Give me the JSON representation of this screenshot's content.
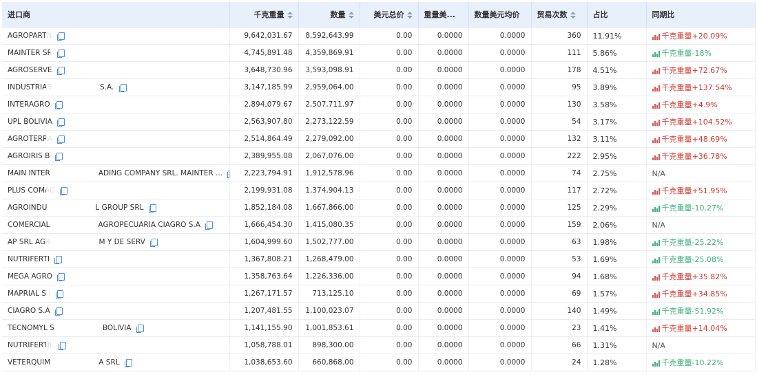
{
  "columns": {
    "importer": "进口商",
    "weight_kg": "千克重量",
    "quantity": "数量",
    "usd_total": "美元总价",
    "weight_usd": "重量美...",
    "qty_usd_avg": "数量美元均价",
    "trade_count": "贸易次数",
    "share": "占比",
    "yoy": "同期比"
  },
  "rows": [
    {
      "name": "AGROPARTN",
      "suffix": "",
      "weight": "9,642,031.67",
      "qty": "8,592,643.99",
      "usd": "0.00",
      "wusd": "0.0000",
      "qusd": "0.0000",
      "count": "360",
      "share": "11.91%",
      "trend": "up",
      "yoy_label": "千克重量",
      "yoy_value": "+20.09%"
    },
    {
      "name": "MAINTER SR",
      "suffix": "",
      "weight": "4,745,891.48",
      "qty": "4,359,869.91",
      "usd": "0.00",
      "wusd": "0.0000",
      "qusd": "0.0000",
      "count": "111",
      "share": "5.86%",
      "trend": "down",
      "yoy_label": "千克重量",
      "yoy_value": "-18%"
    },
    {
      "name": "AGROSERVE",
      "suffix": "",
      "weight": "3,648,730.96",
      "qty": "3,593,098.91",
      "usd": "0.00",
      "wusd": "0.0000",
      "qusd": "0.0000",
      "count": "178",
      "share": "4.51%",
      "trend": "up",
      "yoy_label": "千克重量",
      "yoy_value": "+72.67%"
    },
    {
      "name": "INDUSTRIAS",
      "suffix": "S.A.",
      "weight": "3,147,185.99",
      "qty": "2,959,064.00",
      "usd": "0.00",
      "wusd": "0.0000",
      "qusd": "0.0000",
      "count": "95",
      "share": "3.89%",
      "trend": "up",
      "yoy_label": "千克重量",
      "yoy_value": "+137.54%"
    },
    {
      "name": "INTERAGRO",
      "suffix": "",
      "weight": "2,894,079.67",
      "qty": "2,507,711.97",
      "usd": "0.00",
      "wusd": "0.0000",
      "qusd": "0.0000",
      "count": "130",
      "share": "3.58%",
      "trend": "up",
      "yoy_label": "千克重量",
      "yoy_value": "+4.9%"
    },
    {
      "name": "UPL BOLIVIA",
      "suffix": "",
      "weight": "2,563,907.80",
      "qty": "2,273,122.59",
      "usd": "0.00",
      "wusd": "0.0000",
      "qusd": "0.0000",
      "count": "54",
      "share": "3.17%",
      "trend": "up",
      "yoy_label": "千克重量",
      "yoy_value": "+104.52%"
    },
    {
      "name": "AGROTERRA",
      "suffix": "",
      "weight": "2,514,864.49",
      "qty": "2,279,092.00",
      "usd": "0.00",
      "wusd": "0.0000",
      "qusd": "0.0000",
      "count": "132",
      "share": "3.11%",
      "trend": "up",
      "yoy_label": "千克重量",
      "yoy_value": "+48.69%"
    },
    {
      "name": "AGROIRIS B",
      "suffix": "",
      "weight": "2,389,955.08",
      "qty": "2,067,076.00",
      "usd": "0.00",
      "wusd": "0.0000",
      "qusd": "0.0000",
      "count": "222",
      "share": "2.95%",
      "trend": "up",
      "yoy_label": "千克重量",
      "yoy_value": "+36.78%"
    },
    {
      "name": "MAIN INTER",
      "suffix": "ADING COMPANY SRL. MAINTER ...",
      "weight": "2,223,794.91",
      "qty": "1,912,578.96",
      "usd": "0.00",
      "wusd": "0.0000",
      "qusd": "0.0000",
      "count": "74",
      "share": "2.75%",
      "trend": "na",
      "yoy_label": "",
      "yoy_value": "N/A"
    },
    {
      "name": "PLUS COMAG",
      "suffix": "",
      "weight": "2,199,931.08",
      "qty": "1,374,904.13",
      "usd": "0.00",
      "wusd": "0.0000",
      "qusd": "0.0000",
      "count": "117",
      "share": "2.72%",
      "trend": "up",
      "yoy_label": "千克重量",
      "yoy_value": "+51.95%"
    },
    {
      "name": "AGROINDU",
      "suffix": "L GROUP SRL",
      "weight": "1,852,184.08",
      "qty": "1,667,866.00",
      "usd": "0.00",
      "wusd": "0.0000",
      "qusd": "0.0000",
      "count": "125",
      "share": "2.29%",
      "trend": "down",
      "yoy_label": "千克重量",
      "yoy_value": "-10.27%"
    },
    {
      "name": "COMERCIAL",
      "suffix": "AGROPECUARIA CIAGRO S.A",
      "weight": "1,666,454.30",
      "qty": "1,415,080.35",
      "usd": "0.00",
      "wusd": "0.0000",
      "qusd": "0.0000",
      "count": "159",
      "share": "2.06%",
      "trend": "na",
      "yoy_label": "",
      "yoy_value": "N/A"
    },
    {
      "name": "AP SRL AGR",
      "suffix": "M Y DE SERV",
      "weight": "1,604,999.60",
      "qty": "1,502,777.00",
      "usd": "0.00",
      "wusd": "0.0000",
      "qusd": "0.0000",
      "count": "63",
      "share": "1.98%",
      "trend": "down",
      "yoy_label": "千克重量",
      "yoy_value": "-25.22%"
    },
    {
      "name": "NUTRIFERTI",
      "suffix": "",
      "weight": "1,367,808.21",
      "qty": "1,268,479.00",
      "usd": "0.00",
      "wusd": "0.0000",
      "qusd": "0.0000",
      "count": "53",
      "share": "1.69%",
      "trend": "down",
      "yoy_label": "千克重量",
      "yoy_value": "-25.08%"
    },
    {
      "name": "MEGA AGRO",
      "suffix": "",
      "weight": "1,358,763.64",
      "qty": "1,226,336.00",
      "usd": "0.00",
      "wusd": "0.0000",
      "qusd": "0.0000",
      "count": "94",
      "share": "1.68%",
      "trend": "up",
      "yoy_label": "千克重量",
      "yoy_value": "+35.82%"
    },
    {
      "name": "MAPRIAL S.I",
      "suffix": "",
      "weight": "1,267,171.57",
      "qty": "713,125.10",
      "usd": "0.00",
      "wusd": "0.0000",
      "qusd": "0.0000",
      "count": "69",
      "share": "1.57%",
      "trend": "up",
      "yoy_label": "千克重量",
      "yoy_value": "+34.85%"
    },
    {
      "name": "CIAGRO S.A",
      "suffix": "",
      "weight": "1,207,481.55",
      "qty": "1,100,023.07",
      "usd": "0.00",
      "wusd": "0.0000",
      "qusd": "0.0000",
      "count": "140",
      "share": "1.49%",
      "trend": "down",
      "yoy_label": "千克重量",
      "yoy_value": "-51.92%"
    },
    {
      "name": "TECNOMYL S",
      "suffix": "BOLIVIA",
      "weight": "1,141,155.90",
      "qty": "1,001,853.61",
      "usd": "0.00",
      "wusd": "0.0000",
      "qusd": "0.0000",
      "count": "23",
      "share": "1.41%",
      "trend": "up",
      "yoy_label": "千克重量",
      "yoy_value": "+14.04%"
    },
    {
      "name": "NUTRIFERTIL",
      "suffix": "",
      "weight": "1,058,788.01",
      "qty": "898,300.00",
      "usd": "0.00",
      "wusd": "0.0000",
      "qusd": "0.0000",
      "count": "66",
      "share": "1.31%",
      "trend": "na",
      "yoy_label": "",
      "yoy_value": "N/A"
    },
    {
      "name": "VETERQUIM",
      "suffix": "A SRL",
      "weight": "1,038,653.60",
      "qty": "660,868.00",
      "usd": "0.00",
      "wusd": "0.0000",
      "qusd": "0.0000",
      "count": "24",
      "share": "1.28%",
      "trend": "down",
      "yoy_label": "千克重量",
      "yoy_value": "-10.22%"
    }
  ],
  "colors": {
    "header_bg": "#e8f0fc",
    "trend_up": "#d0342c",
    "trend_down": "#3bb07a",
    "copy_icon": "#4a90e2"
  }
}
